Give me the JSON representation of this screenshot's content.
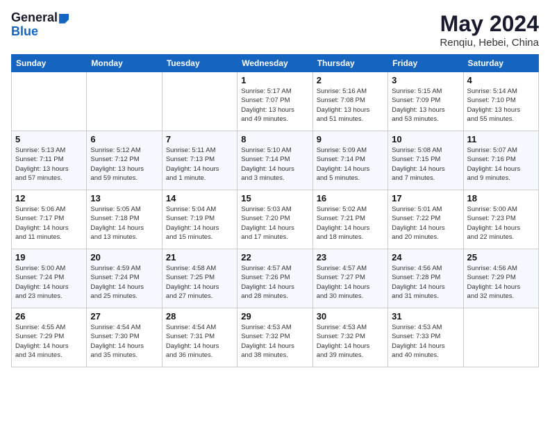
{
  "header": {
    "logo_general": "General",
    "logo_blue": "Blue",
    "month": "May 2024",
    "location": "Renqiu, Hebei, China"
  },
  "weekdays": [
    "Sunday",
    "Monday",
    "Tuesday",
    "Wednesday",
    "Thursday",
    "Friday",
    "Saturday"
  ],
  "weeks": [
    [
      {
        "day": "",
        "info": ""
      },
      {
        "day": "",
        "info": ""
      },
      {
        "day": "",
        "info": ""
      },
      {
        "day": "1",
        "info": "Sunrise: 5:17 AM\nSunset: 7:07 PM\nDaylight: 13 hours\nand 49 minutes."
      },
      {
        "day": "2",
        "info": "Sunrise: 5:16 AM\nSunset: 7:08 PM\nDaylight: 13 hours\nand 51 minutes."
      },
      {
        "day": "3",
        "info": "Sunrise: 5:15 AM\nSunset: 7:09 PM\nDaylight: 13 hours\nand 53 minutes."
      },
      {
        "day": "4",
        "info": "Sunrise: 5:14 AM\nSunset: 7:10 PM\nDaylight: 13 hours\nand 55 minutes."
      }
    ],
    [
      {
        "day": "5",
        "info": "Sunrise: 5:13 AM\nSunset: 7:11 PM\nDaylight: 13 hours\nand 57 minutes."
      },
      {
        "day": "6",
        "info": "Sunrise: 5:12 AM\nSunset: 7:12 PM\nDaylight: 13 hours\nand 59 minutes."
      },
      {
        "day": "7",
        "info": "Sunrise: 5:11 AM\nSunset: 7:13 PM\nDaylight: 14 hours\nand 1 minute."
      },
      {
        "day": "8",
        "info": "Sunrise: 5:10 AM\nSunset: 7:14 PM\nDaylight: 14 hours\nand 3 minutes."
      },
      {
        "day": "9",
        "info": "Sunrise: 5:09 AM\nSunset: 7:14 PM\nDaylight: 14 hours\nand 5 minutes."
      },
      {
        "day": "10",
        "info": "Sunrise: 5:08 AM\nSunset: 7:15 PM\nDaylight: 14 hours\nand 7 minutes."
      },
      {
        "day": "11",
        "info": "Sunrise: 5:07 AM\nSunset: 7:16 PM\nDaylight: 14 hours\nand 9 minutes."
      }
    ],
    [
      {
        "day": "12",
        "info": "Sunrise: 5:06 AM\nSunset: 7:17 PM\nDaylight: 14 hours\nand 11 minutes."
      },
      {
        "day": "13",
        "info": "Sunrise: 5:05 AM\nSunset: 7:18 PM\nDaylight: 14 hours\nand 13 minutes."
      },
      {
        "day": "14",
        "info": "Sunrise: 5:04 AM\nSunset: 7:19 PM\nDaylight: 14 hours\nand 15 minutes."
      },
      {
        "day": "15",
        "info": "Sunrise: 5:03 AM\nSunset: 7:20 PM\nDaylight: 14 hours\nand 17 minutes."
      },
      {
        "day": "16",
        "info": "Sunrise: 5:02 AM\nSunset: 7:21 PM\nDaylight: 14 hours\nand 18 minutes."
      },
      {
        "day": "17",
        "info": "Sunrise: 5:01 AM\nSunset: 7:22 PM\nDaylight: 14 hours\nand 20 minutes."
      },
      {
        "day": "18",
        "info": "Sunrise: 5:00 AM\nSunset: 7:23 PM\nDaylight: 14 hours\nand 22 minutes."
      }
    ],
    [
      {
        "day": "19",
        "info": "Sunrise: 5:00 AM\nSunset: 7:24 PM\nDaylight: 14 hours\nand 23 minutes."
      },
      {
        "day": "20",
        "info": "Sunrise: 4:59 AM\nSunset: 7:24 PM\nDaylight: 14 hours\nand 25 minutes."
      },
      {
        "day": "21",
        "info": "Sunrise: 4:58 AM\nSunset: 7:25 PM\nDaylight: 14 hours\nand 27 minutes."
      },
      {
        "day": "22",
        "info": "Sunrise: 4:57 AM\nSunset: 7:26 PM\nDaylight: 14 hours\nand 28 minutes."
      },
      {
        "day": "23",
        "info": "Sunrise: 4:57 AM\nSunset: 7:27 PM\nDaylight: 14 hours\nand 30 minutes."
      },
      {
        "day": "24",
        "info": "Sunrise: 4:56 AM\nSunset: 7:28 PM\nDaylight: 14 hours\nand 31 minutes."
      },
      {
        "day": "25",
        "info": "Sunrise: 4:56 AM\nSunset: 7:29 PM\nDaylight: 14 hours\nand 32 minutes."
      }
    ],
    [
      {
        "day": "26",
        "info": "Sunrise: 4:55 AM\nSunset: 7:29 PM\nDaylight: 14 hours\nand 34 minutes."
      },
      {
        "day": "27",
        "info": "Sunrise: 4:54 AM\nSunset: 7:30 PM\nDaylight: 14 hours\nand 35 minutes."
      },
      {
        "day": "28",
        "info": "Sunrise: 4:54 AM\nSunset: 7:31 PM\nDaylight: 14 hours\nand 36 minutes."
      },
      {
        "day": "29",
        "info": "Sunrise: 4:53 AM\nSunset: 7:32 PM\nDaylight: 14 hours\nand 38 minutes."
      },
      {
        "day": "30",
        "info": "Sunrise: 4:53 AM\nSunset: 7:32 PM\nDaylight: 14 hours\nand 39 minutes."
      },
      {
        "day": "31",
        "info": "Sunrise: 4:53 AM\nSunset: 7:33 PM\nDaylight: 14 hours\nand 40 minutes."
      },
      {
        "day": "",
        "info": ""
      }
    ]
  ]
}
